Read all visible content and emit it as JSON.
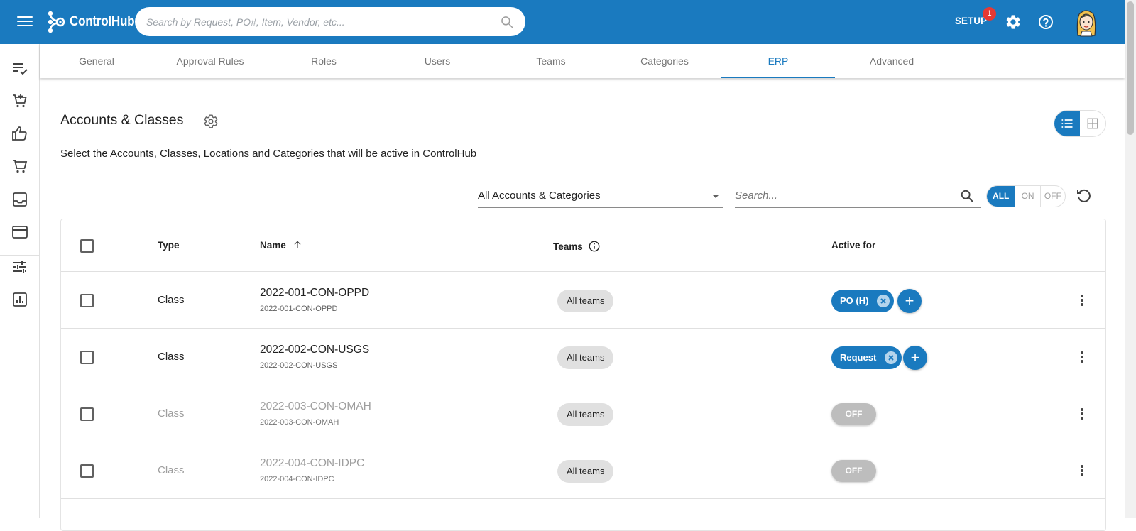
{
  "app": {
    "name": "ControlHub"
  },
  "header": {
    "search_placeholder": "Search by Request, PO#, Item, Vendor, etc...",
    "setup_label": "SETUP",
    "setup_badge": "1"
  },
  "tabs": [
    {
      "label": "General"
    },
    {
      "label": "Approval Rules"
    },
    {
      "label": "Roles"
    },
    {
      "label": "Users"
    },
    {
      "label": "Teams"
    },
    {
      "label": "Categories"
    },
    {
      "label": "ERP",
      "active": true
    },
    {
      "label": "Advanced"
    }
  ],
  "page": {
    "title": "Accounts & Classes",
    "subtitle": "Select the Accounts, Classes, Locations and Categories that will be active in ControlHub"
  },
  "filters": {
    "select_value": "All Accounts & Categories",
    "search_placeholder": "Search...",
    "segments": [
      "ALL",
      "ON",
      "OFF"
    ]
  },
  "table": {
    "headers": {
      "type": "Type",
      "name": "Name",
      "teams": "Teams",
      "active_for": "Active for"
    },
    "rows": [
      {
        "type": "Class",
        "name": "2022-001-CON-OPPD",
        "code": "2022-001-CON-OPPD",
        "teams": "All teams",
        "active": "PO (H)"
      },
      {
        "type": "Class",
        "name": "2022-002-CON-USGS",
        "code": "2022-002-CON-USGS",
        "teams": "All teams",
        "active": "Request"
      },
      {
        "type": "Class",
        "name": "2022-003-CON-OMAH",
        "code": "2022-003-CON-OMAH",
        "teams": "All teams",
        "active": "OFF"
      },
      {
        "type": "Class",
        "name": "2022-004-CON-IDPC",
        "code": "2022-004-CON-IDPC",
        "teams": "All teams",
        "active": "OFF"
      }
    ]
  },
  "colors": {
    "primary": "#1a7abf",
    "badge": "#e53935",
    "chip_off": "#bdbdbd"
  }
}
